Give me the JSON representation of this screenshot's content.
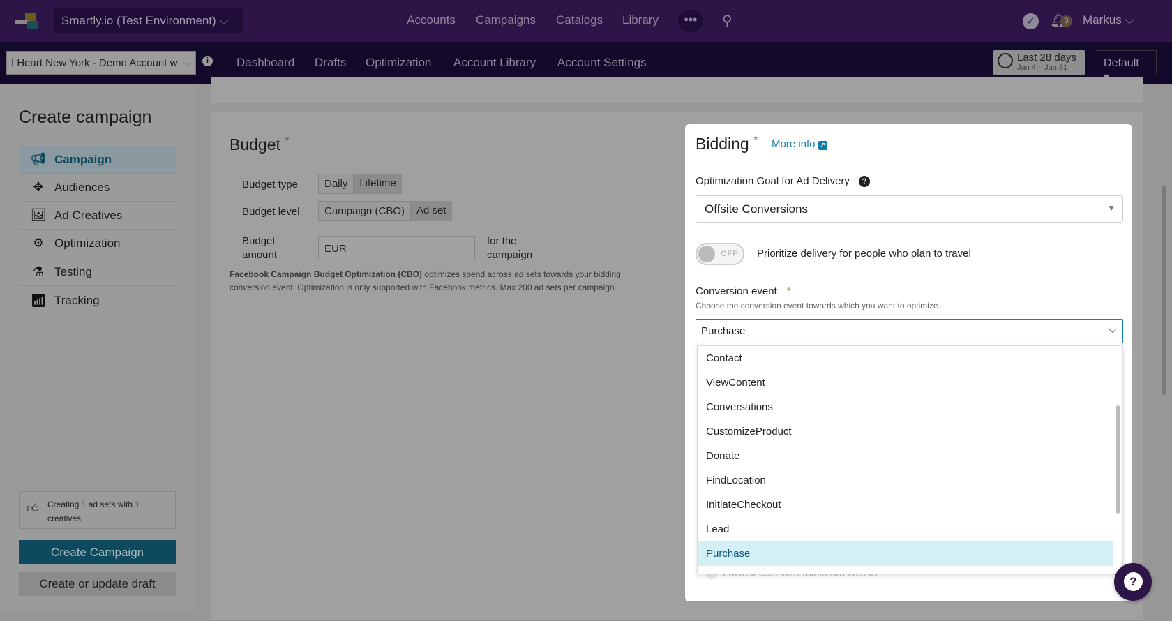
{
  "topbar": {
    "env": "Smartly.io (Test Environment)",
    "nav": [
      "Accounts",
      "Campaigns",
      "Catalogs",
      "Library"
    ],
    "notifications": "3",
    "user": "Markus"
  },
  "subbar": {
    "account": "I Heart New York - Demo Account w",
    "nav": [
      "Dashboard",
      "Drafts",
      "Optimization",
      "Account Library",
      "Account Settings"
    ],
    "date_range": "Last 28 days",
    "date_sub": "Jan 4 – Jan 31",
    "view": "Default"
  },
  "sidebar": {
    "title": "Create campaign",
    "items": [
      {
        "label": "Campaign",
        "icon": "megaphone-icon"
      },
      {
        "label": "Audiences",
        "icon": "crosshair-icon"
      },
      {
        "label": "Ad Creatives",
        "icon": "image-icon"
      },
      {
        "label": "Optimization",
        "icon": "gears-icon"
      },
      {
        "label": "Testing",
        "icon": "flask-icon"
      },
      {
        "label": "Tracking",
        "icon": "bars-icon"
      }
    ],
    "summary": "Creating 1 ad sets with 1 creatives",
    "create_btn": "Create Campaign",
    "draft_btn": "Create or update draft"
  },
  "budget": {
    "title": "Budget",
    "required": "*",
    "type_label": "Budget type",
    "type_options": [
      "Daily",
      "Lifetime"
    ],
    "level_label": "Budget level",
    "level_options": [
      "Campaign (CBO)",
      "Ad set"
    ],
    "amount_label": "Budget amount",
    "currency": "EUR",
    "amount_suffix": "for the campaign",
    "note_bold": "Facebook Campaign Budget Optimization (CBO)",
    "note": " optimizes spend across ad sets towards your bidding conversion event. Optimization is only supported with Facebook metrics. Max 200 ad sets per campaign."
  },
  "bidding": {
    "title": "Bidding",
    "required": "*",
    "more_info": "More info",
    "goal_label": "Optimization Goal for Ad Delivery",
    "goal_value": "Offsite Conversions",
    "toggle_state": "OFF",
    "toggle_label": "Prioritize delivery for people who plan to travel",
    "conv_label": "Conversion event",
    "conv_help": "Choose the conversion event towards which you want to optimize",
    "conv_value": "Purchase",
    "options": [
      "Contact",
      "ViewContent",
      "Conversations",
      "CustomizeProduct",
      "Donate",
      "FindLocation",
      "InitiateCheckout",
      "Lead",
      "Purchase"
    ],
    "selected_index": 8,
    "hidden_option": "Lowest cost with minimum ROAS"
  }
}
